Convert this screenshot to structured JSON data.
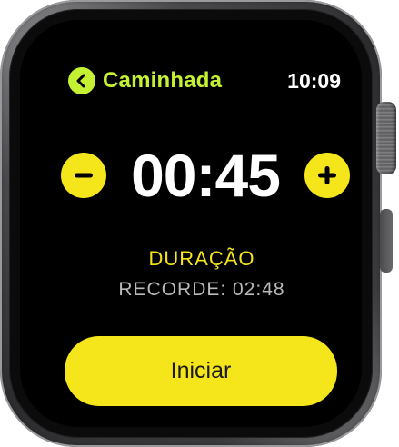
{
  "header": {
    "back_icon": "chevron-left-icon",
    "title": "Caminhada",
    "time": "10:09"
  },
  "goal": {
    "decrease_icon": "minus-icon",
    "value": "00:45",
    "increase_icon": "plus-icon",
    "metric": "DURAÇÃO",
    "record": "RECORDE: 02:48"
  },
  "actions": {
    "start_label": "Iniciar"
  },
  "colors": {
    "accent_green": "#c5f133",
    "accent_yellow": "#f5e51b",
    "screen_bg": "#000000"
  }
}
